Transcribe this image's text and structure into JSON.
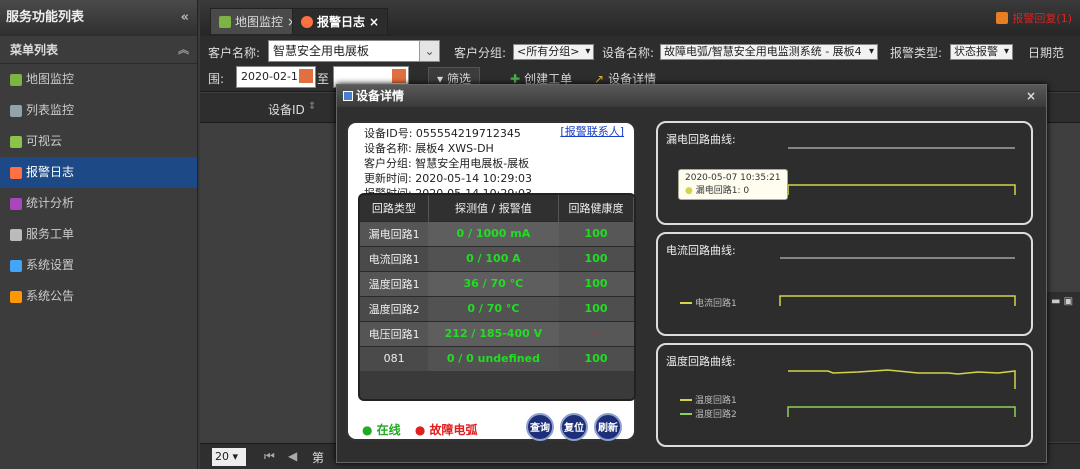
{
  "sidebar": {
    "title": "服务功能列表",
    "collapse_icon": "«",
    "section": "菜单列表",
    "items": [
      {
        "label": "地图监控",
        "icon": "map-icon",
        "color": "#7cb342"
      },
      {
        "label": "列表监控",
        "icon": "list-icon",
        "color": "#90a4ae"
      },
      {
        "label": "可视云",
        "icon": "cloud-icon",
        "color": "#8bc34a"
      },
      {
        "label": "报警日志",
        "icon": "alarm-icon",
        "color": "#ff7043"
      },
      {
        "label": "统计分析",
        "icon": "pie-icon",
        "color": "#ab47bc"
      },
      {
        "label": "服务工单",
        "icon": "ticket-icon",
        "color": "#bbbbbb"
      },
      {
        "label": "系统设置",
        "icon": "gear-icon",
        "color": "#42a5f5"
      },
      {
        "label": "系统公告",
        "icon": "notice-icon",
        "color": "#ff9800"
      }
    ],
    "active_index": 3
  },
  "tabs": [
    {
      "label": "地图监控",
      "close": "×"
    },
    {
      "label": "报警日志",
      "close": "×"
    }
  ],
  "alarm_badge": "报警回复(1)",
  "filter": {
    "customer_label": "客户名称:",
    "customer_value": "智慧安全用电展板",
    "group_label": "客户分组:",
    "group_value": "<所有分组>",
    "device_label": "设备名称:",
    "device_value": "故障电弧/智慧安全用电监测系统 - 展板4",
    "alarm_type_label": "报警类型:",
    "alarm_type_value": "状态报警",
    "date_range_label": "日期范",
    "date_range_label2": "围:",
    "date_from": "2020-02-1",
    "to_label": "至",
    "filter_btn": "筛选",
    "create_ticket": "创建工单",
    "device_detail": "设备详情"
  },
  "grid": {
    "col_device_id": "设备ID"
  },
  "pager": {
    "page_size": "20",
    "page_label": "第"
  },
  "dialog": {
    "title": "设备详情",
    "close": "×",
    "device_id_label": "设备ID号:",
    "device_id": "055554219712345",
    "contact_link": "[报警联系人]",
    "device_name_label": "设备名称:",
    "device_name": "展板4 XWS-DH",
    "group_label": "客户分组:",
    "group": "智慧安全用电展板-展板",
    "update_label": "更新时间:",
    "update_time": "2020-05-14 10:29:03",
    "alarm_label": "报警时间:",
    "alarm_time": "2020-05-14 10:29:03",
    "table": {
      "headers": [
        "回路类型",
        "探测值 / 报警值",
        "回路健康度"
      ],
      "rows": [
        {
          "name": "漏电回路1",
          "value": "0 / 1000 mA",
          "health": "100"
        },
        {
          "name": "电流回路1",
          "value": "0 / 100 A",
          "health": "100"
        },
        {
          "name": "温度回路1",
          "value": "36 / 70 °C",
          "health": "100"
        },
        {
          "name": "温度回路2",
          "value": "0 / 70 °C",
          "health": "100"
        },
        {
          "name": "电压回路1",
          "value": "212 / 185-400 V",
          "health": "-"
        },
        {
          "name": "081",
          "value": "0 / 0 undefined",
          "health": "100"
        }
      ]
    },
    "status_online": "在线",
    "status_fault": "故障电弧",
    "status_online_color": "#22cc22",
    "status_fault_color": "#e02020",
    "btn_query": "查询",
    "btn_reset": "复位",
    "btn_refresh": "刷新",
    "charts": [
      {
        "title": "漏电回路曲线:",
        "tooltip_time": "2020-05-07 10:35:21",
        "tooltip_value": "漏电回路1: 0"
      },
      {
        "title": "电流回路曲线:",
        "legend": [
          "电流回路1"
        ]
      },
      {
        "title": "温度回路曲线:",
        "legend": [
          "温度回路1",
          "温度回路2"
        ]
      }
    ]
  }
}
